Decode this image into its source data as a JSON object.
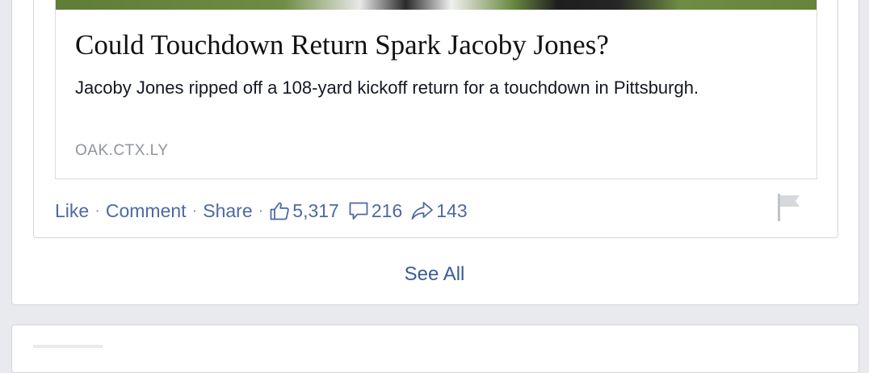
{
  "story": {
    "headline": "Could Touchdown Return Spark Jacoby Jones?",
    "summary": "Jacoby Jones ripped off a 108-yard kickoff return for a touchdown in Pittsburgh.",
    "domain": "OAK.CTX.LY"
  },
  "actions": {
    "like_label": "Like",
    "comment_label": "Comment",
    "share_label": "Share",
    "separator": "·",
    "likes_count": "5,317",
    "comments_count": "216",
    "shares_count": "143"
  },
  "feed": {
    "see_all_label": "See All"
  },
  "icons": {
    "likes": "thumbs-up-icon",
    "comments": "comment-bubble-icon",
    "shares": "share-arrow-icon",
    "report": "flag-icon"
  },
  "colors": {
    "link": "#4e69a2",
    "see_all": "#3b5998",
    "muted": "#90949c",
    "page_background": "#e9eaed"
  }
}
